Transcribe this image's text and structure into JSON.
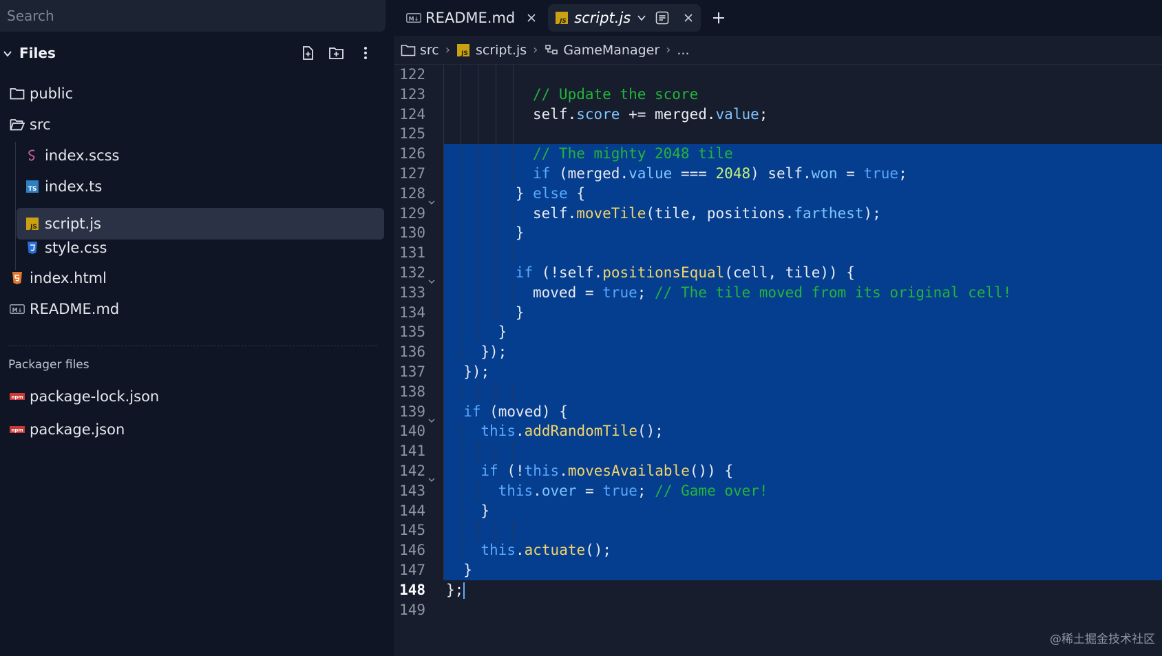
{
  "search": {
    "placeholder": "Search"
  },
  "files_panel": {
    "title": "Files",
    "items": [
      {
        "label": "public",
        "icon": "folder-icon",
        "type": "folder"
      },
      {
        "label": "src",
        "icon": "folder-open-icon",
        "type": "folder"
      },
      {
        "label": "index.scss",
        "icon": "sass-icon",
        "type": "file"
      },
      {
        "label": "index.ts",
        "icon": "typescript-icon",
        "type": "file",
        "badge": "TS"
      },
      {
        "label": "script.js",
        "icon": "javascript-icon",
        "type": "file",
        "badge": "JS",
        "selected": true
      },
      {
        "label": "style.css",
        "icon": "css-icon",
        "type": "file"
      },
      {
        "label": "index.html",
        "icon": "html-icon",
        "type": "file"
      },
      {
        "label": "README.md",
        "icon": "markdown-icon",
        "type": "file",
        "badge": "M↓"
      }
    ],
    "packager_label": "Packager files",
    "packager_items": [
      {
        "label": "package-lock.json",
        "icon": "npm-icon",
        "badge": "npm"
      },
      {
        "label": "package.json",
        "icon": "npm-icon",
        "badge": "npm"
      }
    ]
  },
  "tabs": [
    {
      "label": "README.md",
      "icon": "markdown-icon",
      "badge": "M↓",
      "active": false
    },
    {
      "label": "script.js",
      "icon": "javascript-icon",
      "badge": "JS",
      "active": true
    }
  ],
  "breadcrumb": {
    "items": [
      "src",
      "script.js",
      "GameManager",
      "..."
    ],
    "file_badge": "JS"
  },
  "watermark": "@稀土掘金技术社区",
  "colors": {
    "sidebar_bg": "#0f1524",
    "editor_bg": "#171d2d",
    "selection": "#063e8f",
    "keyword": "#5aa8ff",
    "property": "#7ec6ff",
    "function": "#f1d56b",
    "comment": "#23b53a",
    "number": "#c5f57a"
  },
  "code": {
    "current_line": 148,
    "lines": [
      {
        "n": 122,
        "indent": 0,
        "sel": false,
        "tokens": []
      },
      {
        "n": 123,
        "indent": 5,
        "sel": false,
        "tokens": [
          [
            "cm",
            "// Update the score"
          ]
        ]
      },
      {
        "n": 124,
        "indent": 5,
        "sel": false,
        "tokens": [
          [
            "pl",
            "self"
          ],
          [
            "pl",
            "."
          ],
          [
            "pr",
            "score"
          ],
          [
            "pl",
            " += merged."
          ],
          [
            "pr",
            "value"
          ],
          [
            "pl",
            ";"
          ]
        ]
      },
      {
        "n": 125,
        "indent": 0,
        "sel": false,
        "tokens": []
      },
      {
        "n": 126,
        "indent": 5,
        "sel": true,
        "tokens": [
          [
            "cm",
            "// The mighty 2048 tile"
          ]
        ]
      },
      {
        "n": 127,
        "indent": 5,
        "sel": true,
        "tokens": [
          [
            "kw",
            "if"
          ],
          [
            "pl",
            " (merged."
          ],
          [
            "pr",
            "value"
          ],
          [
            "pl",
            " === "
          ],
          [
            "nm",
            "2048"
          ],
          [
            "pl",
            ") self."
          ],
          [
            "pr",
            "won"
          ],
          [
            "pl",
            " = "
          ],
          [
            "kw",
            "true"
          ],
          [
            "pl",
            ";"
          ]
        ]
      },
      {
        "n": 128,
        "indent": 4,
        "sel": true,
        "fold": true,
        "tokens": [
          [
            "pl",
            "} "
          ],
          [
            "kw",
            "else"
          ],
          [
            "pl",
            " {"
          ]
        ]
      },
      {
        "n": 129,
        "indent": 5,
        "sel": true,
        "tokens": [
          [
            "pl",
            "self."
          ],
          [
            "fn",
            "moveTile"
          ],
          [
            "pl",
            "(tile, positions."
          ],
          [
            "pr",
            "farthest"
          ],
          [
            "pl",
            ");"
          ]
        ]
      },
      {
        "n": 130,
        "indent": 4,
        "sel": true,
        "tokens": [
          [
            "pl",
            "}"
          ]
        ]
      },
      {
        "n": 131,
        "indent": 0,
        "sel": true,
        "tokens": []
      },
      {
        "n": 132,
        "indent": 4,
        "sel": true,
        "fold": true,
        "tokens": [
          [
            "kw",
            "if"
          ],
          [
            "pl",
            " (!self."
          ],
          [
            "fn",
            "positionsEqual"
          ],
          [
            "pl",
            "(cell, tile)) {"
          ]
        ]
      },
      {
        "n": 133,
        "indent": 5,
        "sel": true,
        "tokens": [
          [
            "pl",
            "moved = "
          ],
          [
            "kw",
            "true"
          ],
          [
            "pl",
            "; "
          ],
          [
            "cm",
            "// The tile moved from its original cell!"
          ]
        ]
      },
      {
        "n": 134,
        "indent": 4,
        "sel": true,
        "tokens": [
          [
            "pl",
            "}"
          ]
        ]
      },
      {
        "n": 135,
        "indent": 3,
        "sel": true,
        "tokens": [
          [
            "pl",
            "}"
          ]
        ]
      },
      {
        "n": 136,
        "indent": 2,
        "sel": true,
        "tokens": [
          [
            "pl",
            "});"
          ]
        ]
      },
      {
        "n": 137,
        "indent": 1,
        "sel": true,
        "tokens": [
          [
            "pl",
            "});"
          ]
        ]
      },
      {
        "n": 138,
        "indent": 0,
        "sel": true,
        "tokens": []
      },
      {
        "n": 139,
        "indent": 1,
        "sel": true,
        "fold": true,
        "tokens": [
          [
            "kw",
            "if"
          ],
          [
            "pl",
            " (moved) {"
          ]
        ]
      },
      {
        "n": 140,
        "indent": 2,
        "sel": true,
        "tokens": [
          [
            "kw",
            "this"
          ],
          [
            "pl",
            "."
          ],
          [
            "fn",
            "addRandomTile"
          ],
          [
            "pl",
            "();"
          ]
        ]
      },
      {
        "n": 141,
        "indent": 0,
        "sel": true,
        "tokens": []
      },
      {
        "n": 142,
        "indent": 2,
        "sel": true,
        "fold": true,
        "tokens": [
          [
            "kw",
            "if"
          ],
          [
            "pl",
            " (!"
          ],
          [
            "kw",
            "this"
          ],
          [
            "pl",
            "."
          ],
          [
            "fn",
            "movesAvailable"
          ],
          [
            "pl",
            "()) {"
          ]
        ]
      },
      {
        "n": 143,
        "indent": 3,
        "sel": true,
        "tokens": [
          [
            "kw",
            "this"
          ],
          [
            "pl",
            "."
          ],
          [
            "pr",
            "over"
          ],
          [
            "pl",
            " = "
          ],
          [
            "kw",
            "true"
          ],
          [
            "pl",
            "; "
          ],
          [
            "cm",
            "// Game over!"
          ]
        ]
      },
      {
        "n": 144,
        "indent": 2,
        "sel": true,
        "tokens": [
          [
            "pl",
            "}"
          ]
        ]
      },
      {
        "n": 145,
        "indent": 0,
        "sel": true,
        "tokens": []
      },
      {
        "n": 146,
        "indent": 2,
        "sel": true,
        "tokens": [
          [
            "kw",
            "this"
          ],
          [
            "pl",
            "."
          ],
          [
            "fn",
            "actuate"
          ],
          [
            "pl",
            "();"
          ]
        ]
      },
      {
        "n": 147,
        "indent": 1,
        "sel": true,
        "tokens": [
          [
            "pl",
            "}"
          ]
        ]
      },
      {
        "n": 148,
        "indent": 0,
        "sel": false,
        "cursor": true,
        "tokens": [
          [
            "pl",
            "};"
          ]
        ]
      },
      {
        "n": 149,
        "indent": 0,
        "sel": false,
        "tokens": []
      }
    ]
  }
}
